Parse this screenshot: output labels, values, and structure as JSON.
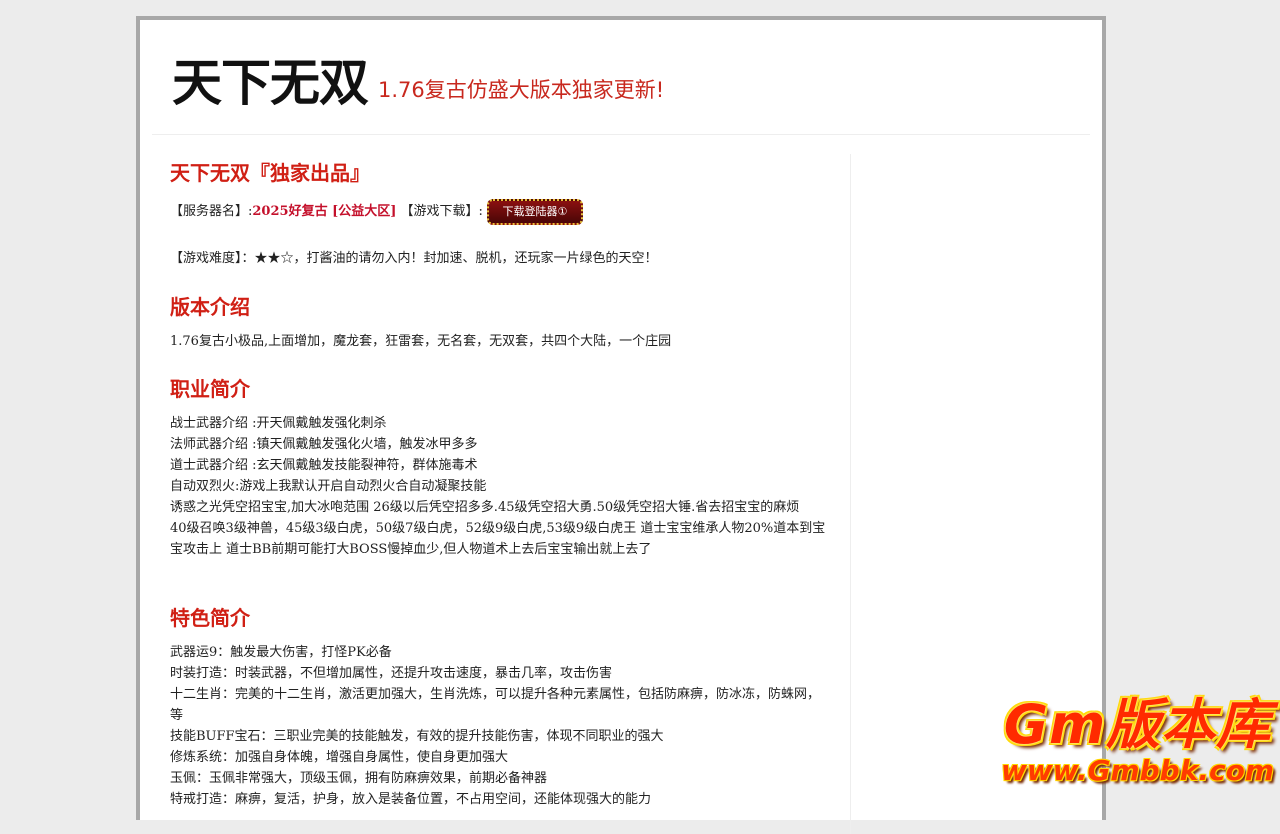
{
  "header": {
    "title": "天下无双",
    "slogan": "1.76复古仿盛大版本独家更新!"
  },
  "intro": {
    "heading": "天下无双『独家出品』",
    "server_label": "【服务器名】:",
    "server_name": "2025好复古 [公益大区]",
    "download_label": "【游戏下载】:",
    "download_button": "下载登陆器①",
    "difficulty": "【游戏难度】：★★☆，打酱油的请勿入内！封加速、脱机，还玩家一片绿色的天空！"
  },
  "version": {
    "heading": "版本介绍",
    "text": "1.76复古小极品,上面增加，魔龙套，狂雷套，无名套，无双套，共四个大陆，一个庄园"
  },
  "classes": {
    "heading": "职业简介",
    "lines": [
      "战士武器介绍 :开天佩戴触发强化刺杀",
      "法师武器介绍 :镇天佩戴触发强化火墙，触发冰甲多多",
      "道士武器介绍 :玄天佩戴触发技能裂神符，群体施毒术",
      "自动双烈火:游戏上我默认开启自动烈火合自动凝聚技能",
      "诱惑之光凭空招宝宝,加大冰咆范围 26级以后凭空招多多.45级凭空招大勇.50级凭空招大锤.省去招宝宝的麻烦",
      "40级召唤3级神兽，45级3级白虎，50级7级白虎，52级9级白虎,53级9级白虎王 道士宝宝维承人物20%道本到宝宝攻击上 道士BB前期可能打大BOSS慢掉血少,但人物道术上去后宝宝输出就上去了"
    ]
  },
  "features": {
    "heading": "特色简介",
    "lines": [
      "武器运9：触发最大伤害，打怪PK必备",
      "时装打造：时装武器，不但增加属性，还提升攻击速度，暴击几率，攻击伤害",
      "十二生肖：完美的十二生肖，激活更加强大，生肖洗炼，可以提升各种元素属性，包括防麻痹，防冰冻，防蛛网，等",
      "技能BUFF宝石：三职业完美的技能触发，有效的提升技能伤害，体现不同职业的强大",
      "修炼系统：加强自身体魄，增强自身属性，使自身更加强大",
      "玉佩：玉佩非常强大，顶级玉佩，拥有防麻痹效果，前期必备神器",
      "特戒打造：麻痹，复活，护身，放入是装备位置，不占用空间，还能体现强大的能力"
    ]
  },
  "watermark": {
    "top": "Gm版本库",
    "bottom": "www.Gmbbk.com"
  }
}
